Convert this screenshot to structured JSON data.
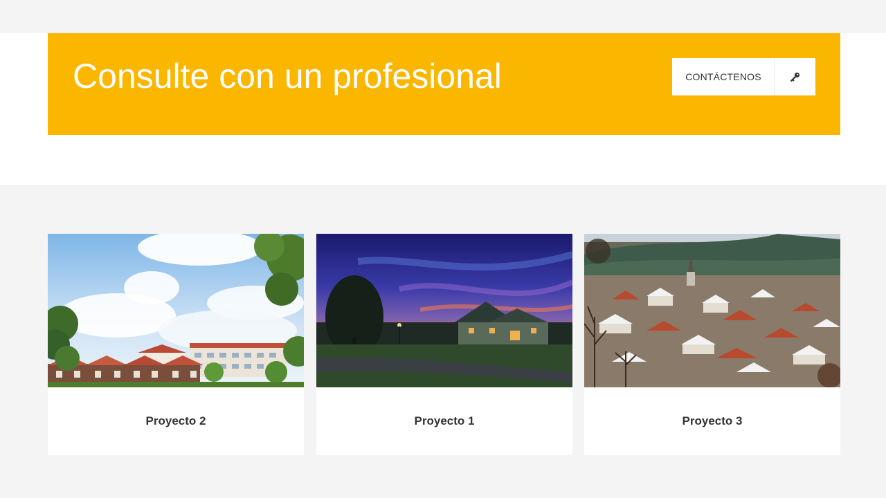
{
  "cta": {
    "title": "Consulte con un profesional",
    "button_label": "CONTÁCTENOS",
    "button_icon": "key-icon",
    "accent_color": "#fbb600"
  },
  "projects": [
    {
      "title": "Proyecto 2",
      "image": "suburban-row-houses-photo"
    },
    {
      "title": "Proyecto 1",
      "image": "house-at-dusk-photo"
    },
    {
      "title": "Proyecto 3",
      "image": "snowy-town-aerial-photo"
    }
  ]
}
